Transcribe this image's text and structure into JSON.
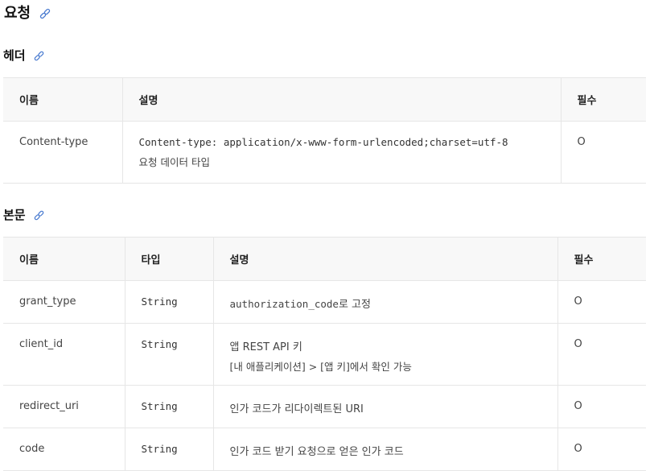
{
  "request": {
    "title": "요청"
  },
  "header_section": {
    "title": "헤더",
    "columns": [
      "이름",
      "설명",
      "필수"
    ],
    "rows": [
      {
        "name": "Content-type",
        "desc_line1": "Content-type: application/x-www-form-urlencoded;charset=utf-8",
        "desc_line2": "요청 데이터 타입",
        "required": "O"
      }
    ]
  },
  "body_section": {
    "title": "본문",
    "columns": [
      "이름",
      "타입",
      "설명",
      "필수"
    ],
    "rows": [
      {
        "name": "grant_type",
        "type": "String",
        "desc_code": "authorization_code",
        "desc_suffix": "로 고정",
        "required": "O"
      },
      {
        "name": "client_id",
        "type": "String",
        "desc_line1": "앱 REST API 키",
        "desc_line2": "[내 애플리케이션] > [앱 키]에서 확인 가능",
        "required": "O"
      },
      {
        "name": "redirect_uri",
        "type": "String",
        "desc_line1": "인가 코드가 리다이렉트된 URI",
        "required": "O"
      },
      {
        "name": "code",
        "type": "String",
        "desc_line1": "인가 코드 받기 요청으로 얻은 인가 코드",
        "required": "O"
      }
    ]
  },
  "icons": {
    "anchor": "link-icon"
  }
}
